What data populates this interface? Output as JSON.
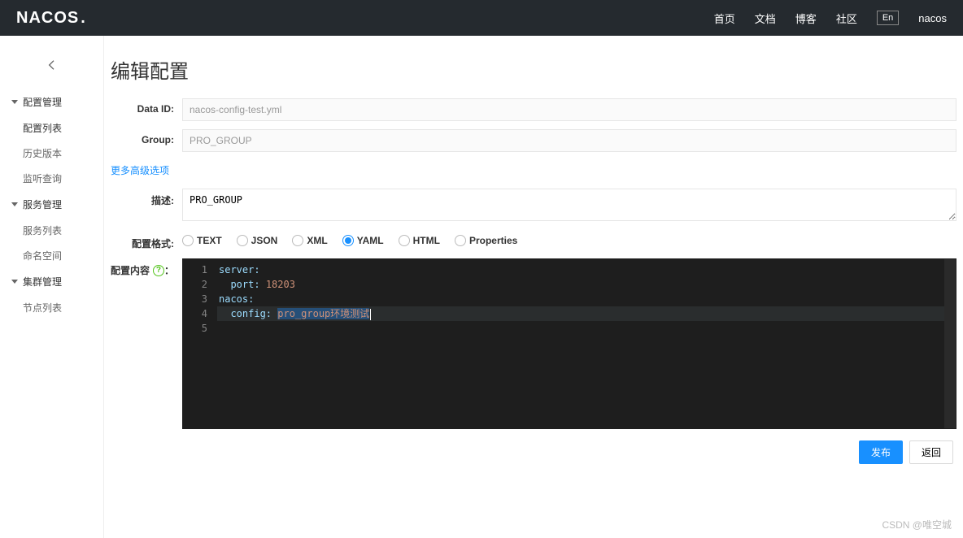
{
  "brand": "NACOS",
  "header": {
    "links": [
      "首页",
      "文档",
      "博客",
      "社区"
    ],
    "lang": "En",
    "user": "nacos"
  },
  "sidebar": {
    "groups": [
      {
        "label": "配置管理",
        "items": [
          "配置列表",
          "历史版本",
          "监听查询"
        ],
        "activeIndex": 0
      },
      {
        "label": "服务管理",
        "items": [
          "服务列表",
          "命名空间"
        ]
      },
      {
        "label": "集群管理",
        "items": [
          "节点列表"
        ]
      }
    ]
  },
  "page": {
    "title": "编辑配置",
    "labels": {
      "dataId": "Data ID:",
      "group": "Group:",
      "advanced": "更多高级选项",
      "description": "描述:",
      "format": "配置格式:",
      "content": "配置内容",
      "publish": "发布",
      "back": "返回"
    },
    "values": {
      "dataId": "nacos-config-test.yml",
      "group": "PRO_GROUP",
      "description": "PRO_GROUP"
    },
    "formats": [
      "TEXT",
      "JSON",
      "XML",
      "YAML",
      "HTML",
      "Properties"
    ],
    "formatSelected": "YAML",
    "editor": {
      "lines": [
        {
          "n": 1,
          "segs": [
            {
              "t": "server:",
              "c": "tok-key"
            }
          ]
        },
        {
          "n": 2,
          "segs": [
            {
              "t": "  ",
              "c": "tok-plain"
            },
            {
              "t": "port: ",
              "c": "tok-key"
            },
            {
              "t": "18203",
              "c": "tok-str"
            }
          ]
        },
        {
          "n": 3,
          "segs": []
        },
        {
          "n": 4,
          "segs": [
            {
              "t": "nacos:",
              "c": "tok-key"
            }
          ]
        },
        {
          "n": 5,
          "segs": [
            {
              "t": "  ",
              "c": "tok-plain"
            },
            {
              "t": "config: ",
              "c": "tok-key"
            },
            {
              "t": "pro_group环境测试",
              "c": "tok-str",
              "sel": true
            }
          ],
          "current": true
        }
      ]
    }
  },
  "watermark": "CSDN @唯空城"
}
